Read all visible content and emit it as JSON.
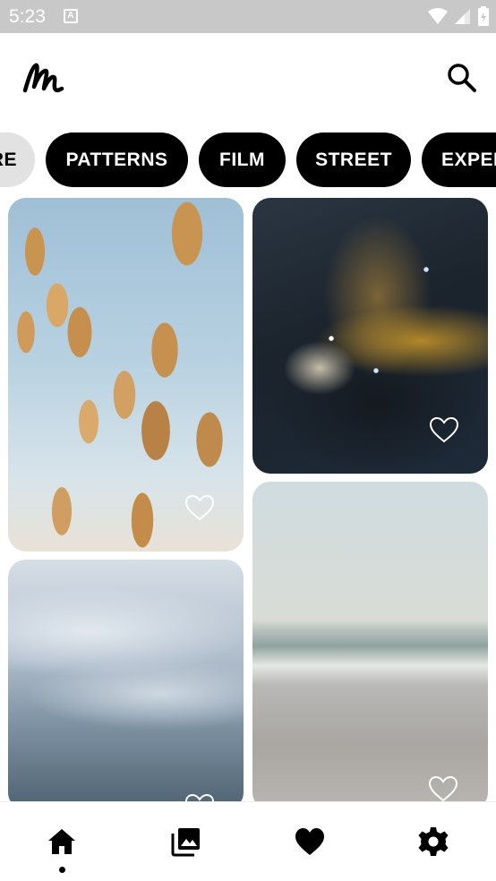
{
  "status_bar": {
    "time": "5:23",
    "notification_icon": "a-icon",
    "icons": [
      "wifi-icon",
      "cell-signal-icon",
      "battery-icon"
    ]
  },
  "header": {
    "logo_icon": "brand-logo-icon",
    "search_icon": "search-icon"
  },
  "chips": [
    {
      "label": "RE",
      "active": false
    },
    {
      "label": "PATTERNS",
      "active": true
    },
    {
      "label": "FILM",
      "active": true
    },
    {
      "label": "STREET",
      "active": true
    },
    {
      "label": "EXPERIMENTAL",
      "active": true
    }
  ],
  "grid": {
    "items": [
      {
        "subject": "dried grass photo",
        "favorite_icon": "heart-outline-icon",
        "favorited": false
      },
      {
        "subject": "nebula photo",
        "favorite_icon": "heart-outline-icon",
        "favorited": false
      },
      {
        "subject": "misty forest photo",
        "favorite_icon": "heart-outline-icon",
        "favorited": false
      },
      {
        "subject": "sea shore photo",
        "favorite_icon": "heart-outline-icon",
        "favorited": false
      }
    ]
  },
  "bottom_nav": {
    "items": [
      {
        "icon": "home-icon",
        "selected": true
      },
      {
        "icon": "gallery-icon",
        "selected": false
      },
      {
        "icon": "heart-filled-icon",
        "selected": false
      },
      {
        "icon": "settings-gear-icon",
        "selected": false
      }
    ]
  },
  "colors": {
    "chip_bg": "#000000",
    "chip_text": "#ffffff",
    "chip_inactive_bg": "#e2e2e2",
    "status_bar_bg": "#c8c8c8"
  }
}
